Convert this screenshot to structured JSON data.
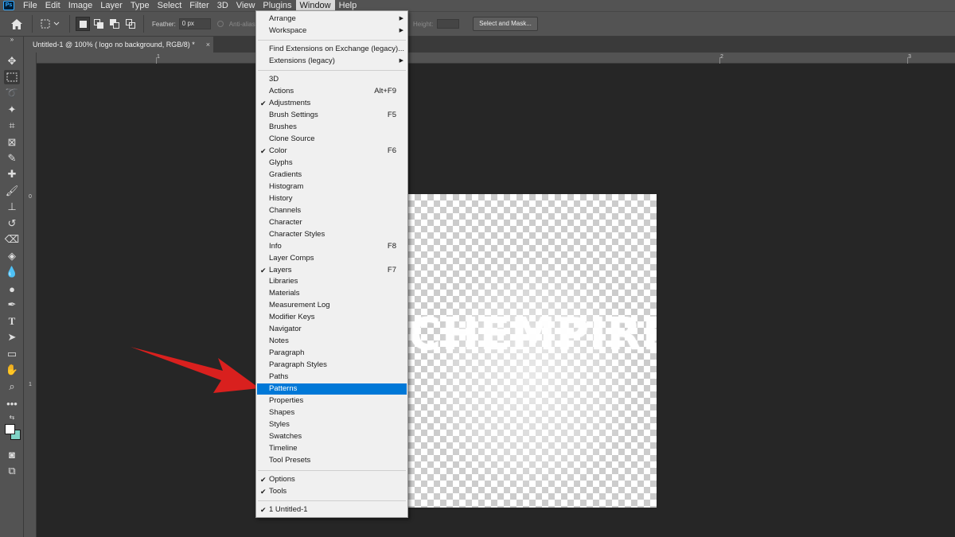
{
  "menubar": {
    "app_icon": "Ps",
    "items": [
      "File",
      "Edit",
      "Image",
      "Layer",
      "Type",
      "Select",
      "Filter",
      "3D",
      "View",
      "Plugins",
      "Window",
      "Help"
    ]
  },
  "options": {
    "feather_label": "Feather:",
    "feather_value": "0 px",
    "antialias_label": "Anti-alias",
    "height_label": "Height:",
    "select_mask": "Select and Mask..."
  },
  "document": {
    "tab_title": "Untitled-1 @ 100% ( logo no background, RGB/8) *",
    "tab_close": "×",
    "canvas_text": "CHEMPIRE"
  },
  "ruler": {
    "top": [
      "1",
      "2",
      "3"
    ],
    "left": [
      "0",
      "1"
    ]
  },
  "window_menu": {
    "arrange": "Arrange",
    "workspace": "Workspace",
    "find_extensions": "Find Extensions on Exchange (legacy)...",
    "extensions": "Extensions (legacy)",
    "panels": [
      {
        "label": "3D",
        "checked": false,
        "shortcut": ""
      },
      {
        "label": "Actions",
        "checked": false,
        "shortcut": "Alt+F9"
      },
      {
        "label": "Adjustments",
        "checked": true,
        "shortcut": ""
      },
      {
        "label": "Brush Settings",
        "checked": false,
        "shortcut": "F5"
      },
      {
        "label": "Brushes",
        "checked": false,
        "shortcut": ""
      },
      {
        "label": "Clone Source",
        "checked": false,
        "shortcut": ""
      },
      {
        "label": "Color",
        "checked": true,
        "shortcut": "F6"
      },
      {
        "label": "Glyphs",
        "checked": false,
        "shortcut": ""
      },
      {
        "label": "Gradients",
        "checked": false,
        "shortcut": ""
      },
      {
        "label": "Histogram",
        "checked": false,
        "shortcut": ""
      },
      {
        "label": "History",
        "checked": false,
        "shortcut": ""
      },
      {
        "label": "Channels",
        "checked": false,
        "shortcut": ""
      },
      {
        "label": "Character",
        "checked": false,
        "shortcut": ""
      },
      {
        "label": "Character Styles",
        "checked": false,
        "shortcut": ""
      },
      {
        "label": "Info",
        "checked": false,
        "shortcut": "F8"
      },
      {
        "label": "Layer Comps",
        "checked": false,
        "shortcut": ""
      },
      {
        "label": "Layers",
        "checked": true,
        "shortcut": "F7"
      },
      {
        "label": "Libraries",
        "checked": false,
        "shortcut": ""
      },
      {
        "label": "Materials",
        "checked": false,
        "shortcut": ""
      },
      {
        "label": "Measurement Log",
        "checked": false,
        "shortcut": ""
      },
      {
        "label": "Modifier Keys",
        "checked": false,
        "shortcut": ""
      },
      {
        "label": "Navigator",
        "checked": false,
        "shortcut": ""
      },
      {
        "label": "Notes",
        "checked": false,
        "shortcut": ""
      },
      {
        "label": "Paragraph",
        "checked": false,
        "shortcut": ""
      },
      {
        "label": "Paragraph Styles",
        "checked": false,
        "shortcut": ""
      },
      {
        "label": "Paths",
        "checked": false,
        "shortcut": ""
      },
      {
        "label": "Patterns",
        "checked": false,
        "shortcut": "",
        "highlighted": true
      },
      {
        "label": "Properties",
        "checked": false,
        "shortcut": ""
      },
      {
        "label": "Shapes",
        "checked": false,
        "shortcut": ""
      },
      {
        "label": "Styles",
        "checked": false,
        "shortcut": ""
      },
      {
        "label": "Swatches",
        "checked": false,
        "shortcut": ""
      },
      {
        "label": "Timeline",
        "checked": false,
        "shortcut": ""
      },
      {
        "label": "Tool Presets",
        "checked": false,
        "shortcut": ""
      }
    ],
    "options": "Options",
    "tools": "Tools",
    "doc_entry": "1 Untitled-1"
  },
  "colors": {
    "highlight": "#0078d7",
    "arrow": "#d9201e",
    "ui_panel": "#535353",
    "canvas_bg": "#262626"
  }
}
